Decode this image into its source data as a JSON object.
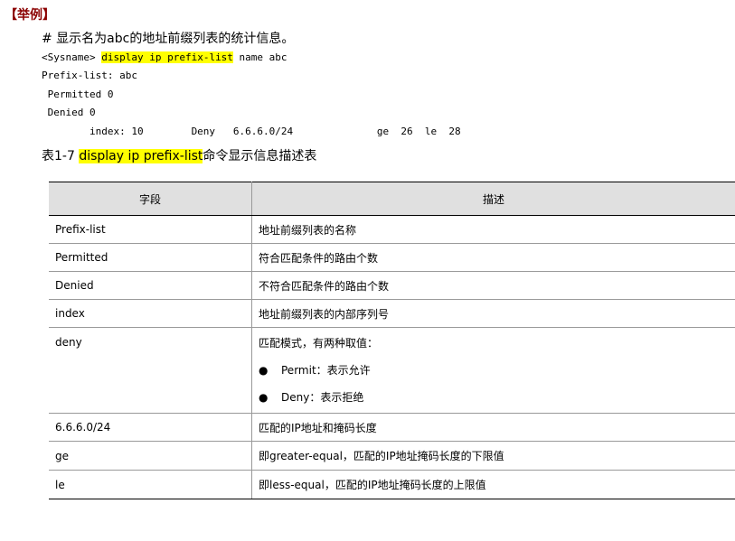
{
  "example_heading": "【举例】",
  "comment": "# 显示名为abc的地址前缀列表的统计信息。",
  "code": {
    "line1_prefix": "<Sysname> ",
    "line1_command": "display ip prefix-list",
    "line1_suffix": " name abc",
    "line2": "Prefix-list: abc",
    "line3": " Permitted 0",
    "line4": " Denied 0",
    "line5": "        index: 10        Deny   6.6.6.0/24              ge  26  le  28"
  },
  "caption": {
    "prefix": "表1-7 ",
    "command": "display ip prefix-list",
    "suffix": "命令显示信息描述表"
  },
  "table": {
    "headers": [
      "字段",
      "描述"
    ],
    "rows": [
      {
        "field": "Prefix-list",
        "desc": "地址前缀列表的名称"
      },
      {
        "field": "Permitted",
        "desc": "符合匹配条件的路由个数"
      },
      {
        "field": "Denied",
        "desc": "不符合匹配条件的路由个数"
      },
      {
        "field": "index",
        "desc": "地址前缀列表的内部序列号"
      },
      {
        "field": "deny",
        "desc": "匹配模式，有两种取值：",
        "bullets": [
          "Permit：表示允许",
          "Deny：表示拒绝"
        ]
      },
      {
        "field": "6.6.6.0/24",
        "desc": "匹配的IP地址和掩码长度"
      },
      {
        "field": "ge",
        "desc": "即greater-equal，匹配的IP地址掩码长度的下限值"
      },
      {
        "field": "le",
        "desc": "即less-equal，匹配的IP地址掩码长度的上限值"
      }
    ]
  },
  "colors": {
    "heading": "#8b0000",
    "highlight": "#ffff00",
    "header_bg": "#e0e0e0"
  }
}
